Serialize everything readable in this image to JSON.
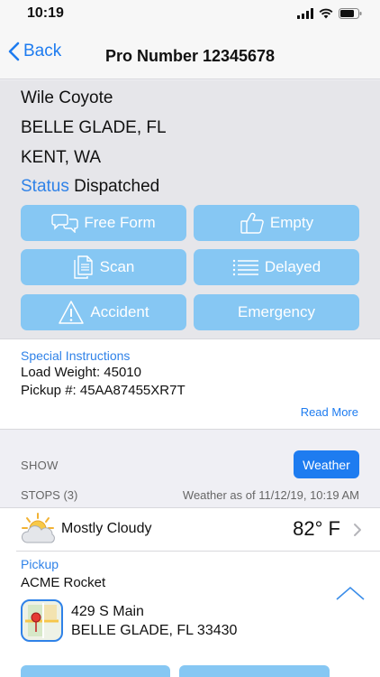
{
  "status_bar": {
    "time": "10:19"
  },
  "nav": {
    "back_label": "Back",
    "title": "Pro Number 12345678"
  },
  "shipment": {
    "customer": "Wile Coyote",
    "origin": "BELLE GLADE, FL",
    "destination": "KENT, WA",
    "status_label": "Status",
    "status_value": "Dispatched"
  },
  "actions": [
    {
      "label": "Free Form",
      "icon": "speech-bubbles-icon"
    },
    {
      "label": "Empty",
      "icon": "thumbs-up-icon"
    },
    {
      "label": "Scan",
      "icon": "documents-icon"
    },
    {
      "label": "Delayed",
      "icon": "list-icon"
    },
    {
      "label": "Accident",
      "icon": "warning-icon"
    },
    {
      "label": "Emergency",
      "icon": ""
    }
  ],
  "instructions": {
    "title": "Special Instructions",
    "lines": [
      "Load Weight: 45010",
      "Pickup #: 45AA87455XR7T"
    ],
    "read_more": "Read More"
  },
  "stops_header": {
    "show_label": "SHOW",
    "weather_button": "Weather",
    "stops_label": "STOPS (3)",
    "weather_as_of": "Weather as of 11/12/19, 10:19 AM"
  },
  "weather": {
    "condition": "Mostly Cloudy",
    "temperature": "82° F",
    "icon": "mostly-cloudy-icon"
  },
  "stop": {
    "type": "Pickup",
    "name": "ACME Rocket",
    "address_line1": "429 S Main",
    "address_line2": "BELLE GLADE, FL 33430",
    "icon": "map-pin-icon"
  },
  "colors": {
    "accent": "#1e7cf0",
    "label_blue": "#2f82e8",
    "action_button": "#86c7f3",
    "info_background": "#e6e6ea"
  }
}
